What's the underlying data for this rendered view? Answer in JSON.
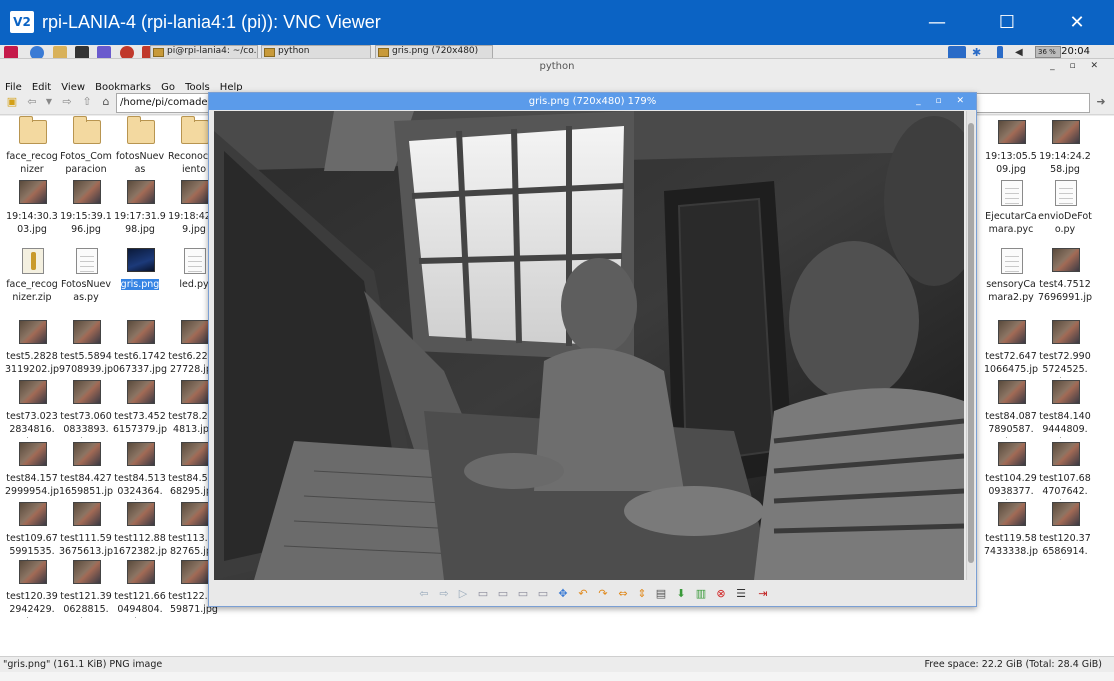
{
  "vnc": {
    "logo": "V2",
    "title": "rpi-LANIA-4 (rpi-lania4:1 (pi)): VNC Viewer",
    "minimize": "—",
    "maximize": "☐",
    "close": "✕"
  },
  "taskbar": {
    "tasks": [
      {
        "label": "pi@rpi-lania4: ~/co..."
      },
      {
        "label": "python"
      },
      {
        "label": "gris.png (720x480)"
      }
    ],
    "cpu": "36 %",
    "clock": "20:04"
  },
  "file_manager": {
    "title": "python",
    "controls": "_ ▫ ✕",
    "menu": [
      "File",
      "Edit",
      "View",
      "Bookmarks",
      "Go",
      "Tools",
      "Help"
    ],
    "path": "/home/pi/comades/",
    "files": [
      {
        "label": "face_recognizer",
        "icon": "folder"
      },
      {
        "label": "Fotos_Comparacion",
        "icon": "folder"
      },
      {
        "label": "fotosNuevas",
        "icon": "folder"
      },
      {
        "label": "Reconocimiento",
        "icon": "folder"
      },
      {
        "label": "19:13:05.509.jpg",
        "icon": "photo"
      },
      {
        "label": "19:14:24.258.jpg",
        "icon": "photo"
      },
      {
        "label": "19:14:30.303.jpg",
        "icon": "photo"
      },
      {
        "label": "19:15:39.196.jpg",
        "icon": "photo"
      },
      {
        "label": "19:17:31.998.jpg",
        "icon": "photo"
      },
      {
        "label": "19:18:42.89.jpg",
        "icon": "photo"
      },
      {
        "label": "EjecutarCamara.pyc",
        "icon": "doc"
      },
      {
        "label": "envioDeFoto.py",
        "icon": "doc"
      },
      {
        "label": "face_recognizer.zip",
        "icon": "zip"
      },
      {
        "label": "FotosNuevas.py",
        "icon": "doc"
      },
      {
        "label": "gris.png",
        "icon": "png"
      },
      {
        "label": "led.py",
        "icon": "doc"
      },
      {
        "label": "sensoryCamara2.py",
        "icon": "doc"
      },
      {
        "label": "test4.75127696991.jpg",
        "icon": "photo"
      },
      {
        "label": "test5.28283119202.jpg",
        "icon": "photo"
      },
      {
        "label": "test5.58949708939.jpg",
        "icon": "photo"
      },
      {
        "label": "test6.1742067337.jpg",
        "icon": "photo"
      },
      {
        "label": "test6.223327728.jpg",
        "icon": "photo"
      },
      {
        "label": "test72.6471066475.jpg",
        "icon": "photo"
      },
      {
        "label": "test72.9905724525.j...",
        "icon": "photo"
      },
      {
        "label": "test73.0232834816.j...",
        "icon": "photo"
      },
      {
        "label": "test73.0600833893.j...",
        "icon": "photo"
      },
      {
        "label": "test73.4526157379.jpg",
        "icon": "photo"
      },
      {
        "label": "test78.2504813.jpg",
        "icon": "photo"
      },
      {
        "label": "test84.0877890587.j...",
        "icon": "photo"
      },
      {
        "label": "test84.1409444809.j...",
        "icon": "photo"
      },
      {
        "label": "test84.1572999954.jpg",
        "icon": "photo"
      },
      {
        "label": "test84.4271659851.jpg",
        "icon": "photo"
      },
      {
        "label": "test84.5130324364.j...",
        "icon": "photo"
      },
      {
        "label": "test84.53768295.jpg",
        "icon": "photo"
      },
      {
        "label": "test104.290938377.j...",
        "icon": "photo"
      },
      {
        "label": "test107.684707642.j...",
        "icon": "photo"
      },
      {
        "label": "test109.675991535.j...",
        "icon": "photo"
      },
      {
        "label": "test111.593675613.jpg",
        "icon": "photo"
      },
      {
        "label": "test112.881672382.jpg",
        "icon": "photo"
      },
      {
        "label": "test113.1982765.jpg",
        "icon": "photo"
      },
      {
        "label": "test119.587433338.jpg",
        "icon": "photo"
      },
      {
        "label": "test120.376586914.j...",
        "icon": "photo"
      },
      {
        "label": "test120.392942429.j...",
        "icon": "photo"
      },
      {
        "label": "test121.390628815.j...",
        "icon": "photo"
      },
      {
        "label": "test121.660494804.j...",
        "icon": "photo"
      },
      {
        "label": "test122.2359871.jpg",
        "icon": "photo"
      }
    ],
    "status_left": "\"gris.png\" (161.1 KiB) PNG image",
    "status_right": "Free space: 22.2 GiB (Total: 28.4 GiB)"
  },
  "viewer": {
    "title": "gris.png (720x480) 179%",
    "controls": "_ ▫ ✕",
    "toolbar_icons": [
      "prev-icon",
      "next-icon",
      "play-icon",
      "zoom-out-icon",
      "zoom-in-icon",
      "zoom-fit-icon",
      "zoom-original-icon",
      "fullscreen-icon",
      "rotate-left-icon",
      "rotate-right-icon",
      "flip-horizontal-icon",
      "flip-vertical-icon",
      "open-icon",
      "save-icon",
      "delete-icon",
      "close-icon",
      "preferences-icon",
      "exit-icon"
    ]
  }
}
